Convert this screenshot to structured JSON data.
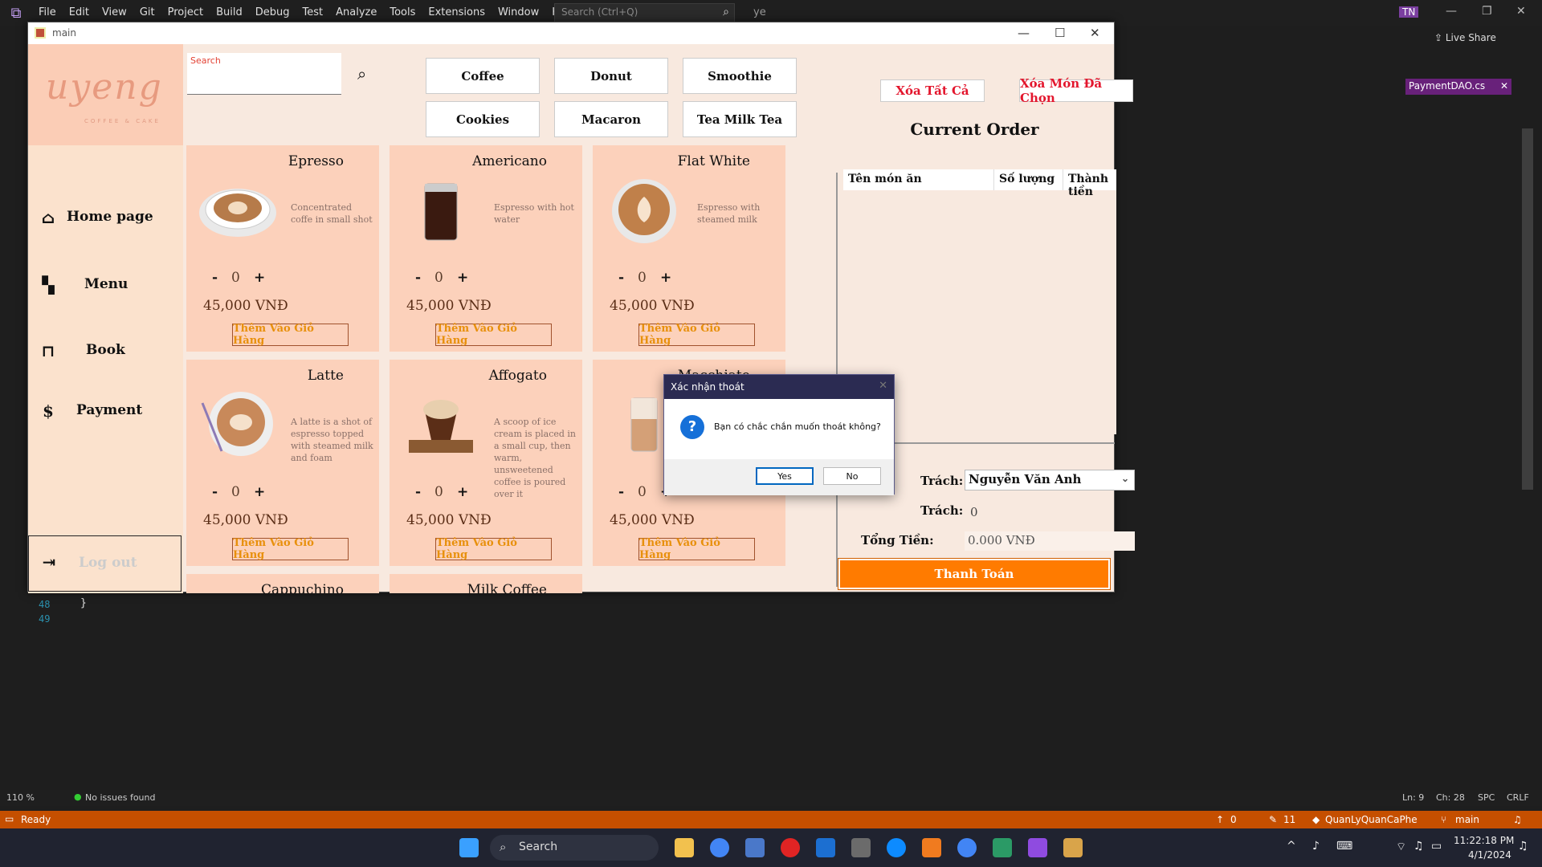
{
  "vs": {
    "menus": [
      "File",
      "Edit",
      "View",
      "Git",
      "Project",
      "Build",
      "Debug",
      "Test",
      "Analyze",
      "Tools",
      "Extensions",
      "Window",
      "Help"
    ],
    "search_placeholder": "Search (Ctrl+Q)",
    "solution_name": "ye",
    "user_initials": "TN",
    "live_share": "Live Share",
    "editor_tab": "PaymentDAO.cs",
    "line_numbers": [
      "48",
      "49"
    ],
    "code_brace": "}",
    "zoom": "110 %",
    "issues": "No issues found",
    "cursor_line": "Ln: 9",
    "cursor_char": "Ch: 28",
    "whitespace": "SPC",
    "line_ending": "CRLF",
    "status_ready": "Ready",
    "status_up": "0",
    "status_pencil": "11",
    "status_repo": "QuanLyQuanCaPhe",
    "status_branch": "main"
  },
  "app": {
    "title": "main",
    "logo_text": "uyeng",
    "logo_sub": "COFFEE & CAKE",
    "nav": [
      {
        "label": "Home page",
        "icon": "home-icon"
      },
      {
        "label": "Menu",
        "icon": "grid-icon"
      },
      {
        "label": "Book",
        "icon": "table-icon"
      },
      {
        "label": "Payment",
        "icon": "payment-icon"
      }
    ],
    "logout_label": "Log out",
    "search_label": "Search",
    "categories": [
      "Coffee",
      "Donut",
      "Smoothie",
      "Cookies",
      "Macaron",
      "Tea  Milk Tea"
    ],
    "products": [
      {
        "name": "Epresso",
        "desc": "Concentrated coffe in small shot",
        "qty": "0",
        "price": "45,000 VNĐ"
      },
      {
        "name": "Americano",
        "desc": "Espresso with hot water",
        "qty": "0",
        "price": "45,000 VNĐ"
      },
      {
        "name": "Flat White",
        "desc": "Espresso with steamed milk",
        "qty": "0",
        "price": "45,000 VNĐ"
      },
      {
        "name": "Latte",
        "desc": "A latte is a shot of espresso topped with steamed milk and foam",
        "qty": "0",
        "price": "45,000 VNĐ"
      },
      {
        "name": "Affogato",
        "desc": "A scoop of ice cream is placed in a small cup, then warm, unsweetened coffee is poured over it",
        "qty": "0",
        "price": "45,000 VNĐ"
      },
      {
        "name": "Macchiato",
        "desc": "",
        "qty": "0",
        "price": "45,000 VNĐ"
      },
      {
        "name": "Cappuchino",
        "desc": "",
        "qty": "",
        "price": ""
      },
      {
        "name": "Milk Coffee",
        "desc": "",
        "qty": "",
        "price": ""
      }
    ],
    "qty_minus": "-",
    "qty_plus": "+",
    "add_to_cart": "Thêm Vào Giỏ Hàng",
    "clear_all": "Xóa Tất Cả",
    "remove_selected": "Xóa Món Đã Chọn",
    "order_title": "Current Order",
    "order_columns": [
      "Tên món ăn",
      "Số lượng",
      "Thành tiền"
    ],
    "staff_label": "Trách:",
    "staff_value": "Nguyễn Văn Anh",
    "discount_label": "Trách:",
    "discount_value": "0",
    "total_label": "Tổng Tiền:",
    "total_value": "0.000 VNĐ",
    "pay_button": "Thanh Toán"
  },
  "dialog": {
    "title": "Xác nhận thoát",
    "message": "Bạn có chắc chắn muốn thoát không?",
    "yes": "Yes",
    "no": "No"
  },
  "taskbar": {
    "search": "Search",
    "time": "11:22:18 PM",
    "date": "4/1/2024"
  }
}
